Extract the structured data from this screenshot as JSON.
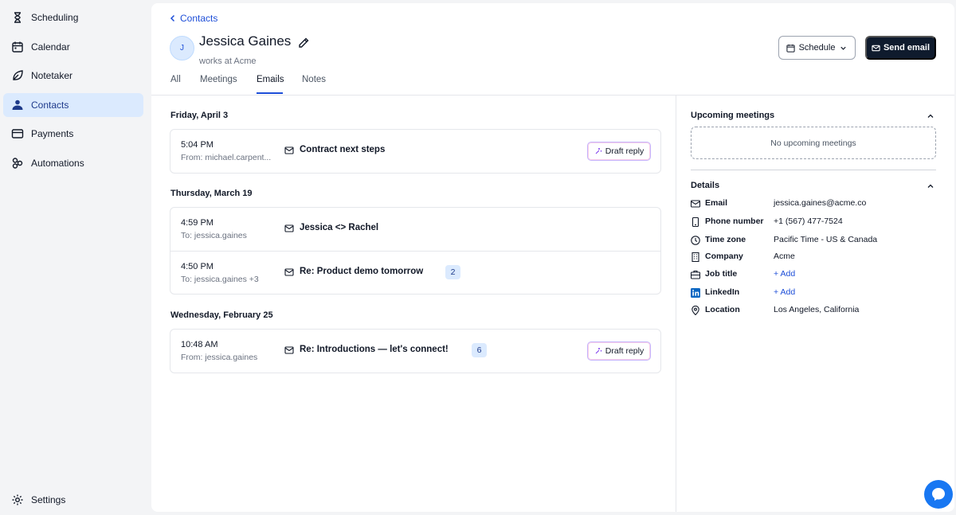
{
  "sidebar": {
    "items": [
      {
        "label": "Scheduling",
        "icon": "hourglass-icon"
      },
      {
        "label": "Calendar",
        "icon": "calendar-icon"
      },
      {
        "label": "Notetaker",
        "icon": "leaf-icon"
      },
      {
        "label": "Contacts",
        "icon": "contacts-icon",
        "active": true
      },
      {
        "label": "Payments",
        "icon": "wallet-icon"
      },
      {
        "label": "Automations",
        "icon": "automations-icon"
      }
    ],
    "settings_label": "Settings"
  },
  "header": {
    "back_label": "Contacts",
    "avatar_initial": "J",
    "name": "Jessica Gaines",
    "works_at": "works at Acme",
    "schedule_label": "Schedule",
    "send_email_label": "Send email"
  },
  "tabs": [
    {
      "label": "All"
    },
    {
      "label": "Meetings"
    },
    {
      "label": "Emails",
      "active": true
    },
    {
      "label": "Notes"
    }
  ],
  "email_groups": [
    {
      "date": "Friday, April 3",
      "emails": [
        {
          "time": "5:04 PM",
          "from": "From: michael.carpent...",
          "subject": "Contract next steps",
          "count": null,
          "draft_label": "Draft reply"
        }
      ]
    },
    {
      "date": "Thursday, March 19",
      "emails": [
        {
          "time": "4:59 PM",
          "from": "To: jessica.gaines",
          "subject": "Jessica <> Rachel",
          "count": null,
          "draft_label": null
        },
        {
          "time": "4:50 PM",
          "from": "To: jessica.gaines +3",
          "subject": "Re: Product demo tomorrow",
          "count": "2",
          "draft_label": null
        }
      ]
    },
    {
      "date": "Wednesday, February 25",
      "emails": [
        {
          "time": "10:48 AM",
          "from": "From: jessica.gaines",
          "subject": "Re: Introductions — let's connect!",
          "count": "6",
          "draft_label": "Draft reply"
        }
      ]
    }
  ],
  "right_panel": {
    "upcoming_title": "Upcoming meetings",
    "no_meetings": "No upcoming meetings",
    "details_title": "Details",
    "details": [
      {
        "label": "Email",
        "value": "jessica.gaines@acme.co",
        "icon": "mail-icon",
        "link": false
      },
      {
        "label": "Phone number",
        "value": "+1 (567) 477-7524",
        "icon": "phone-icon",
        "link": false
      },
      {
        "label": "Time zone",
        "value": "Pacific Time - US & Canada",
        "icon": "clock-icon",
        "link": false
      },
      {
        "label": "Company",
        "value": "Acme",
        "icon": "building-icon",
        "link": false
      },
      {
        "label": "Job title",
        "value": "+ Add",
        "icon": "briefcase-icon",
        "link": true
      },
      {
        "label": "LinkedIn",
        "value": "+ Add",
        "icon": "linkedin-icon",
        "link": true
      },
      {
        "label": "Location",
        "value": "Los Angeles, California",
        "icon": "location-pin-icon",
        "link": false
      }
    ]
  },
  "colors": {
    "accent": "#1d4ed8",
    "active_nav_bg": "#dbeafe",
    "primary_button": "#0f1b2d",
    "chat_bubble": "#1877f2"
  }
}
